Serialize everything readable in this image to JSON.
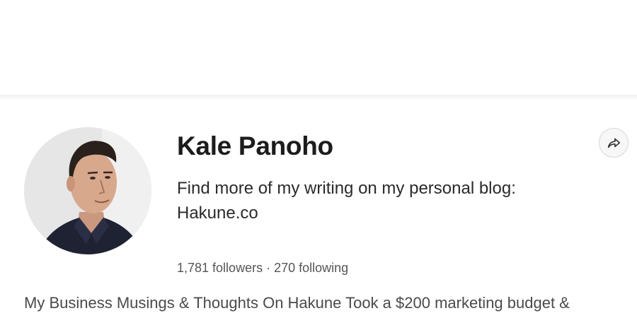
{
  "profile": {
    "name": "Kale Panoho",
    "bio_line1": "Find more of my writing on my personal blog:",
    "bio_line2": "Hakune.co",
    "followers": "1,781 followers",
    "separator": "·",
    "following": "270 following",
    "description": "My Business Musings & Thoughts On Hakune Took a $200 marketing budget &"
  },
  "icons": {
    "share": "share-arrow-icon",
    "avatar": "profile-photo"
  },
  "colors": {
    "name_text": "#1c1c1c",
    "stats_text": "#555555",
    "description_text": "#4a4a4a",
    "share_button_bg": "#f7f7f7",
    "share_button_border": "#d6d6d6"
  }
}
